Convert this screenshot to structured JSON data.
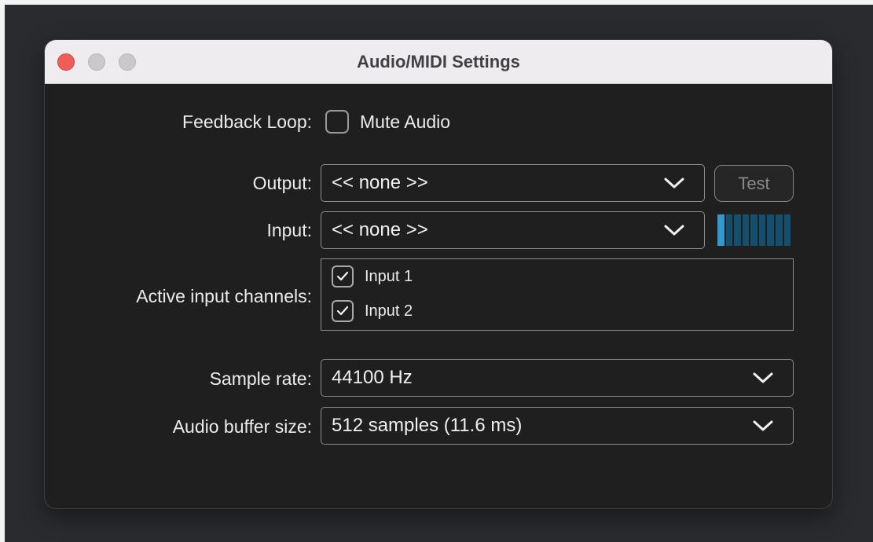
{
  "window": {
    "title": "Audio/MIDI Settings"
  },
  "feedback_loop": {
    "label": "Feedback Loop:",
    "checkbox_label": "Mute Audio",
    "checked": false
  },
  "output": {
    "label": "Output:",
    "value": "<< none >>",
    "test_label": "Test"
  },
  "input": {
    "label": "Input:",
    "value": "<< none >>",
    "level_meter": {
      "segments": 9,
      "lit_segments": 1
    }
  },
  "active_input_channels": {
    "label": "Active input channels:",
    "channels": [
      {
        "label": "Input 1",
        "checked": true
      },
      {
        "label": "Input 2",
        "checked": true
      }
    ]
  },
  "sample_rate": {
    "label": "Sample rate:",
    "value": "44100 Hz"
  },
  "buffer_size": {
    "label": "Audio buffer size:",
    "value": "512 samples (11.6 ms)"
  },
  "icons": {
    "dropdown": "chevron-down-icon",
    "check": "checkmark-icon"
  },
  "colors": {
    "window_bg": "#1f1f20",
    "titlebar_bg": "#efecef",
    "close_button": "#ee5e56",
    "meter_lit": "#3398d0",
    "meter_unlit": "#144f6e"
  }
}
